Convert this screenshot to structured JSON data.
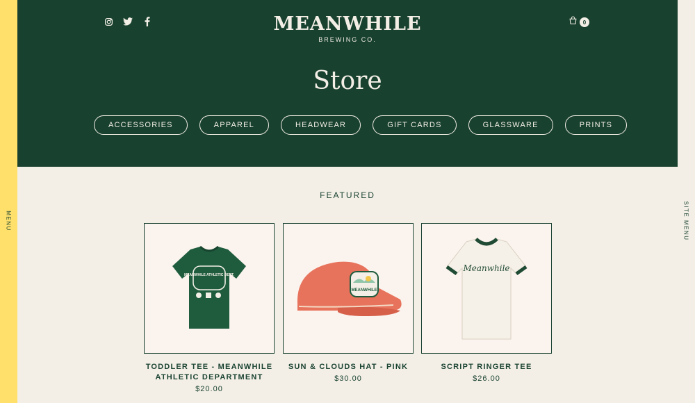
{
  "rails": {
    "left_label": "MENU",
    "right_label": "SITE MENU"
  },
  "header": {
    "social_icons": [
      "instagram-icon",
      "twitter-icon",
      "facebook-icon"
    ],
    "logo_name": "MEANWHILE",
    "logo_sub": "BREWING CO.",
    "cart_count": "0",
    "page_title": "Store",
    "categories": [
      "ACCESSORIES",
      "APPAREL",
      "HEADWEAR",
      "GIFT CARDS",
      "GLASSWARE",
      "PRINTS"
    ]
  },
  "featured": {
    "heading": "FEATURED",
    "products": [
      {
        "name": "TODDLER TEE - MEANWHILE ATHLETIC DEPARTMENT",
        "price": "$20.00",
        "badge_text": "MEANWHILE ATHLETIC DEPT."
      },
      {
        "name": "SUN & CLOUDS HAT - PINK",
        "price": "$30.00",
        "badge_text": "MEANWHILE"
      },
      {
        "name": "SCRIPT RINGER TEE",
        "price": "$26.00",
        "badge_text": "Meanwhile"
      }
    ]
  },
  "colors": {
    "primary_green": "#19412f",
    "accent_yellow": "#ffe06b",
    "cream": "#f3efe6",
    "hat_pink": "#e8735c"
  }
}
